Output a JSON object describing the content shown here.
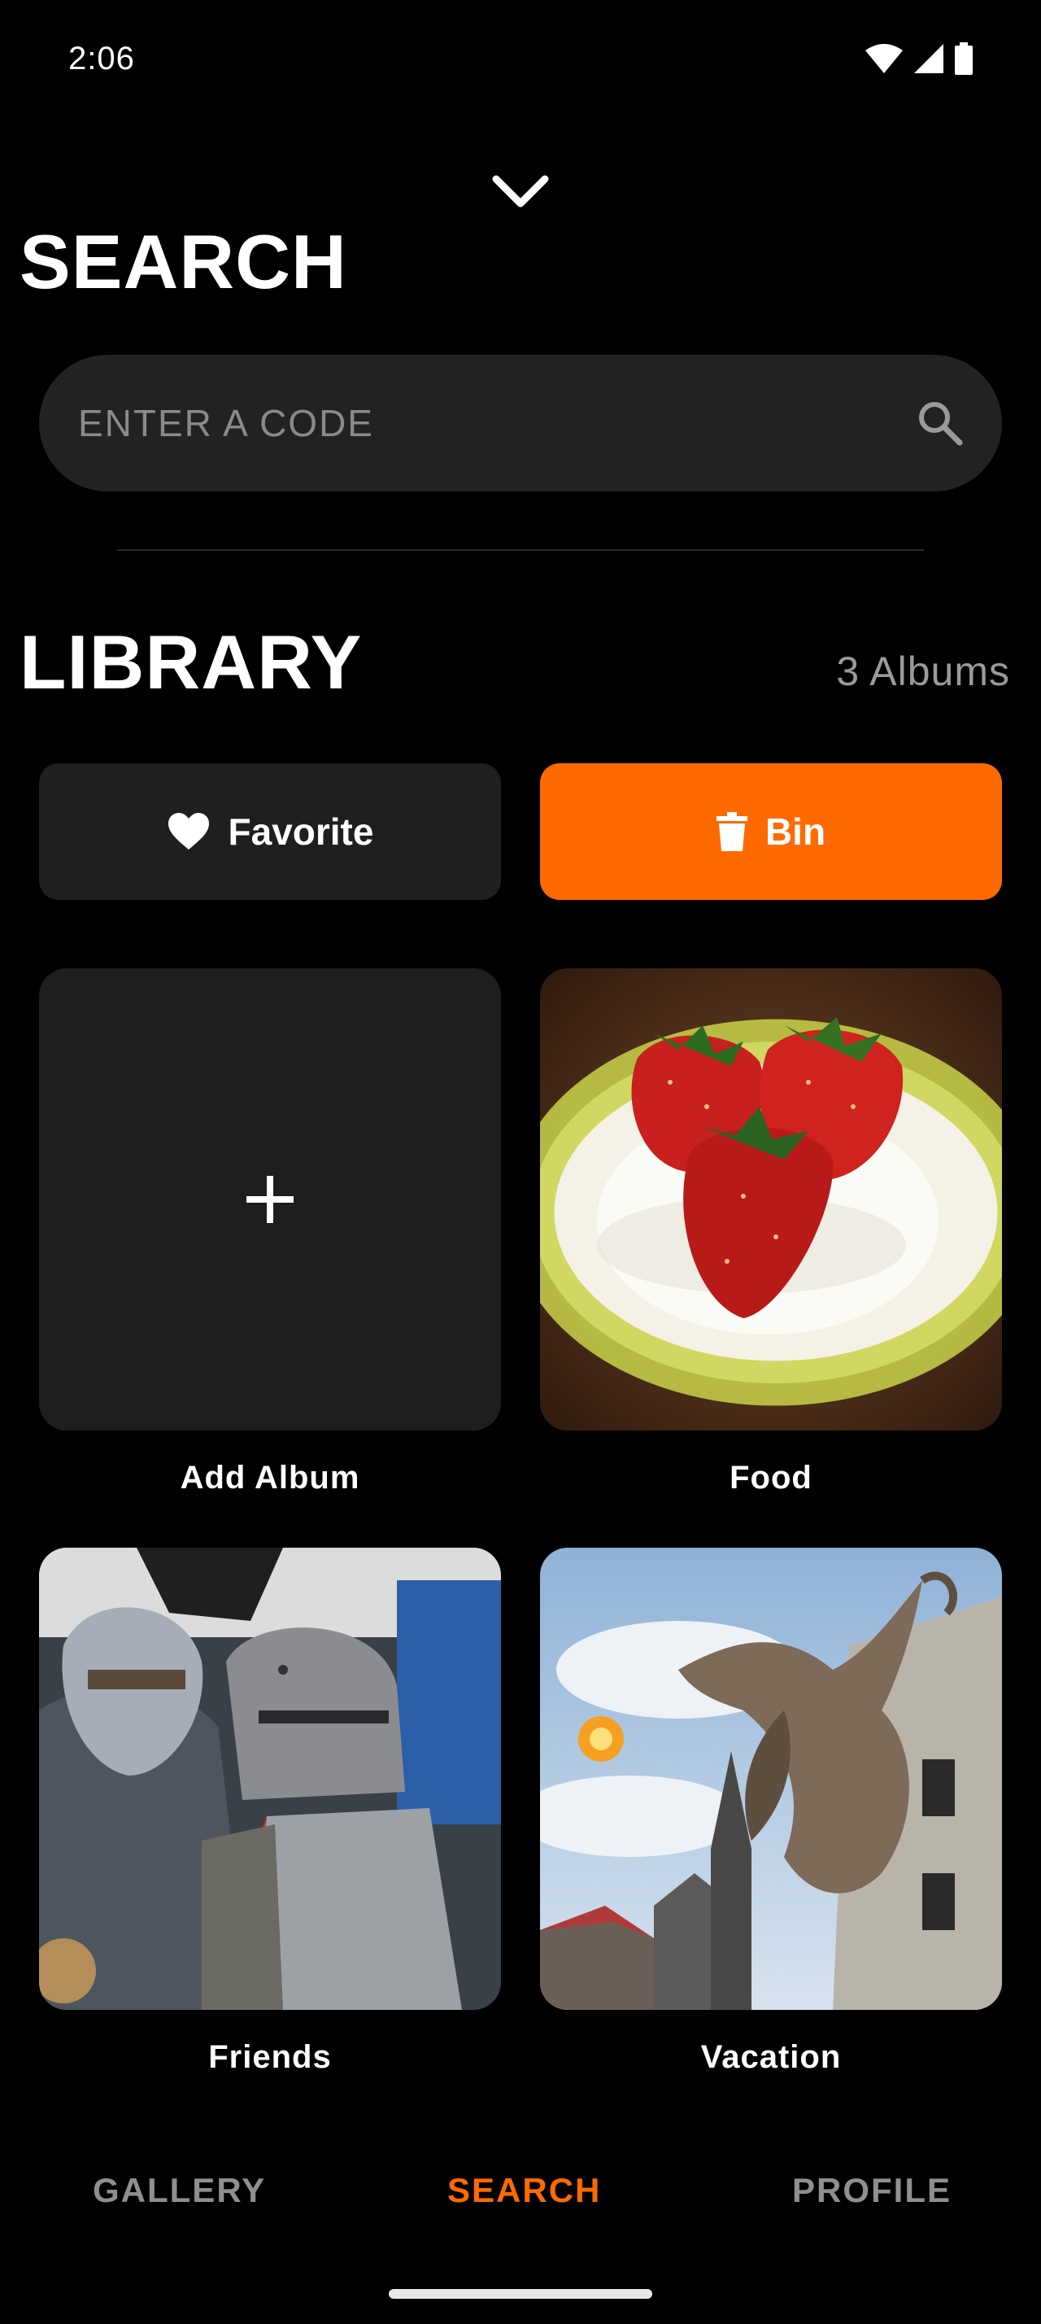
{
  "status_bar": {
    "time": "2:06"
  },
  "search": {
    "title": "SEARCH",
    "placeholder": "ENTER A CODE"
  },
  "library": {
    "title": "LIBRARY",
    "album_count": "3 Albums",
    "favorite_label": "Favorite",
    "bin_label": "Bin",
    "tiles": [
      {
        "label": "Add Album",
        "icon": "plus-icon"
      },
      {
        "label": "Food",
        "image": "strawberries-on-plate"
      },
      {
        "label": "Friends",
        "image": "knights-in-armor"
      },
      {
        "label": "Vacation",
        "image": "dragon-over-castle"
      }
    ]
  },
  "bottom_nav": {
    "tabs": [
      {
        "label": "GALLERY",
        "active": false
      },
      {
        "label": "SEARCH",
        "active": true
      },
      {
        "label": "PROFILE",
        "active": false
      }
    ]
  },
  "colors": {
    "accent": "#ff6a00",
    "background": "#000000",
    "surface": "#222222",
    "muted_text": "#8f8f8f"
  }
}
